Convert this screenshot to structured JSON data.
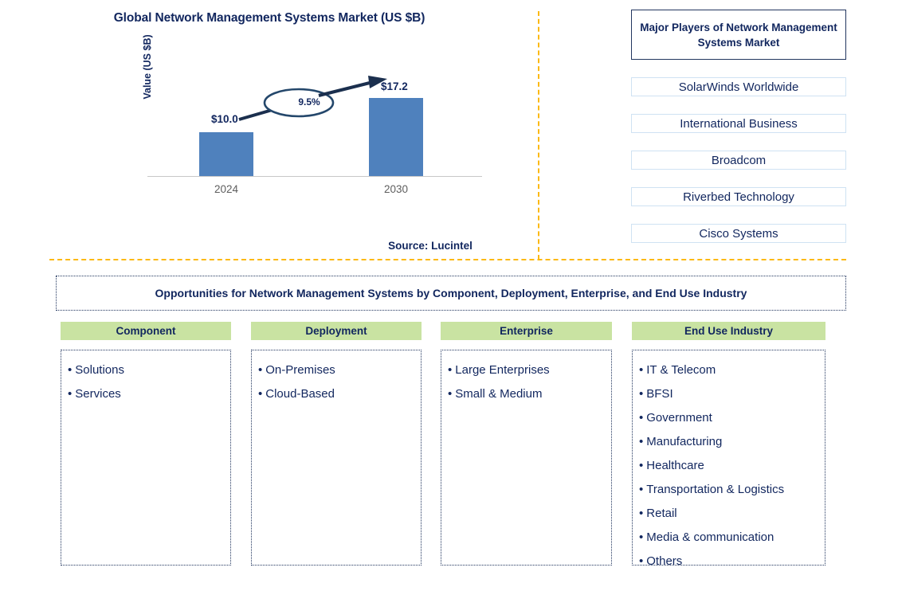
{
  "chart_panel": {
    "title": "Global Network Management Systems Market (US $B)",
    "y_axis_label": "Value (US $B)",
    "source": "Source: Lucintel"
  },
  "chart_data": {
    "type": "bar",
    "title": "Global Network Management Systems Market (US $B)",
    "xlabel": "",
    "ylabel": "Value (US $B)",
    "categories": [
      "2024",
      "2030"
    ],
    "values": [
      10.0,
      17.2
    ],
    "value_labels": [
      "$10.0",
      "$17.2"
    ],
    "ylim": [
      0,
      20
    ],
    "grid": false,
    "legend": null,
    "annotations": [
      {
        "text": "9.5%",
        "type": "cagr-ellipse",
        "from": "2024",
        "to": "2030"
      }
    ],
    "bar_color": "#4f81bd",
    "source": "Source: Lucintel"
  },
  "players": {
    "title": "Major Players of Network Management Systems Market",
    "items": [
      "SolarWinds Worldwide",
      "International Business",
      "Broadcom",
      "Riverbed Technology",
      "Cisco Systems"
    ]
  },
  "opportunities": {
    "banner": "Opportunities for Network Management Systems by Component, Deployment, Enterprise, and End Use Industry",
    "columns": [
      {
        "header": "Component",
        "items": [
          "Solutions",
          "Services"
        ]
      },
      {
        "header": "Deployment",
        "items": [
          "On-Premises",
          "Cloud-Based"
        ]
      },
      {
        "header": "Enterprise",
        "items": [
          "Large Enterprises",
          "Small & Medium"
        ]
      },
      {
        "header": "End Use Industry",
        "items": [
          "IT & Telecom",
          "BFSI",
          "Government",
          "Manufacturing",
          "Healthcare",
          "Transportation & Logistics",
          "Retail",
          "Media & communication",
          "Others"
        ]
      }
    ]
  },
  "colors": {
    "bar": "#4f81bd",
    "navy": "#11265e",
    "accent_orange": "#fcb913",
    "header_green": "#c9e3a2",
    "player_border": "#cfe2f3"
  },
  "bullet": "•"
}
